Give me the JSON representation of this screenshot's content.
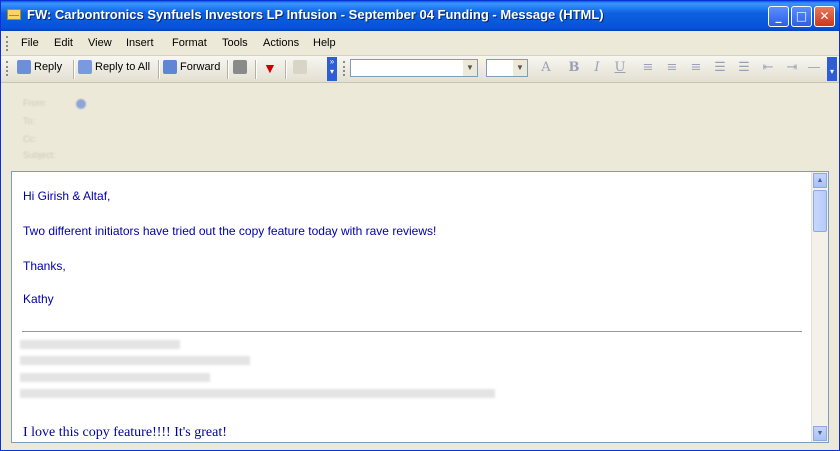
{
  "window": {
    "title": "FW: Carbontronics Synfuels Investors LP Infusion - September 04 Funding - Message (HTML)"
  },
  "menu": [
    "File",
    "Edit",
    "View",
    "Insert",
    "Format",
    "Tools",
    "Actions",
    "Help"
  ],
  "toolbar": {
    "reply": "Reply",
    "reply_all": "Reply to All",
    "forward": "Forward"
  },
  "header": {
    "from_label": "From:",
    "to_label": "To:",
    "cc_label": "Cc:",
    "subject_label": "Subject:",
    "from": "",
    "sent": "",
    "to": "",
    "cc": "",
    "subject": ""
  },
  "body": {
    "greeting": "Hi Girish & Altaf,",
    "line1": "Two different initiators have tried out the copy feature today with rave reviews!",
    "thanks": "Thanks,",
    "signature": "Kathy",
    "quoted_line": "I love this copy feature!!!!  It's great!"
  },
  "icons": {
    "app": "envelope-icon",
    "reply": "reply-icon",
    "reply_all": "reply-all-icon",
    "forward": "forward-icon",
    "print": "print-icon",
    "flag": "flag-icon"
  },
  "colors": {
    "title_bar": "#0553d6",
    "body_text": "#0000a8"
  }
}
